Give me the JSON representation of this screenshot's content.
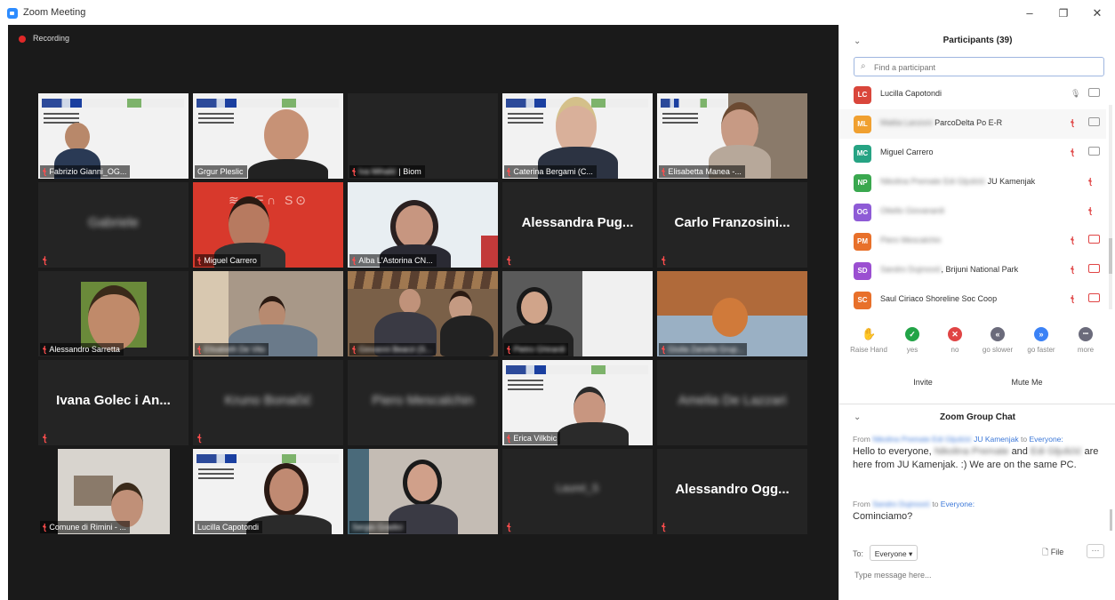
{
  "window": {
    "title": "Zoom Meeting",
    "controls": {
      "minimize": "–",
      "maximize": "❐",
      "close": "✕"
    }
  },
  "meeting": {
    "recording_label": "Recording",
    "tiles": [
      {
        "label": "Fabrizio Gianni_OG...",
        "blur": false,
        "mic_off": true
      },
      {
        "label": "Grgur Pleslic",
        "blur": false,
        "mic_off": false
      },
      {
        "label": "| Biom",
        "blur_prefix": "Iva Mihalić",
        "mic_off": true
      },
      {
        "label": "Caterina Bergami (C...",
        "blur": false,
        "mic_off": true
      },
      {
        "label": "Elisabetta Manea -...",
        "blur": false,
        "mic_off": true
      },
      {
        "big_name": "Gabriele",
        "blur": true
      },
      {
        "label": "Miguel Carrero",
        "blur": false,
        "mic_off": true
      },
      {
        "label": "Alba L'Astorina CN...",
        "blur": false,
        "mic_off": true
      },
      {
        "big_name": "Alessandra Pug...",
        "blur": false
      },
      {
        "big_name": "Carlo Franzosini...",
        "blur": false
      },
      {
        "label": "Alessandro Sarretta",
        "blur": false,
        "mic_off": true
      },
      {
        "label": "Elisabeth De Vito",
        "blur": true,
        "mic_off": true
      },
      {
        "label": "Giovanni Bearzi (S...",
        "blur": true,
        "mic_off": true
      },
      {
        "label": "Pietro Ghirardi",
        "blur": true,
        "mic_off": true
      },
      {
        "label": "Giulia Zanella Grup...",
        "blur": true,
        "mic_off": true
      },
      {
        "big_name": "Ivana Golec i An...",
        "blur": false
      },
      {
        "big_name": "Kruno Bonačić",
        "blur": true
      },
      {
        "big_name": "Piero Mescalchin",
        "blur": true
      },
      {
        "label": "Erica Vilkbic",
        "blur": false,
        "mic_off": true
      },
      {
        "big_name": "Amelia De Lazzari",
        "blur": true
      },
      {
        "label": "Comune di Rimini - ...",
        "blur": false,
        "mic_off": true
      },
      {
        "label": "Lucilla Capotondi",
        "blur": false,
        "mic_off": false
      },
      {
        "label": "Sergio Gradici",
        "blur": true,
        "mic_off": false
      },
      {
        "big_name": "Laurel_S",
        "blur": true
      },
      {
        "big_name": "Alessandro Ogg...",
        "blur": false
      }
    ],
    "slide_header": "www.menti.com 8633797"
  },
  "participants": {
    "title": "Participants (39)",
    "search_placeholder": "Find a participant",
    "list": [
      {
        "initials": "LC",
        "color": "#d9463b",
        "name": "Lucilla Capotondi",
        "name_blur": "",
        "mic": "on",
        "cam": "on"
      },
      {
        "initials": "ML",
        "color": "#f0a030",
        "name": "ParcoDelta Po E-R",
        "name_blur": "Mattia Lanzoni",
        "mic": "off",
        "cam": "on"
      },
      {
        "initials": "MC",
        "color": "#26a383",
        "name": "Miguel Carrero",
        "name_blur": "",
        "mic": "off",
        "cam": "on"
      },
      {
        "initials": "NP",
        "color": "#3aa84f",
        "name": "JU Kamenjak",
        "name_blur": "Nikolina Premate Edi Gljušćić",
        "mic": "off",
        "cam": "none"
      },
      {
        "initials": "OG",
        "color": "#8e5bd6",
        "name": "",
        "name_blur": "Ottello Giovanardi",
        "mic": "off",
        "cam": "none"
      },
      {
        "initials": "PM",
        "color": "#e8702a",
        "name": "",
        "name_blur": "Piero Mescalchin",
        "mic": "off",
        "cam": "off"
      },
      {
        "initials": "SD",
        "color": "#9b4fd1",
        "name": ", Brijuni National Park",
        "name_blur": "Sandro Dujmović",
        "mic": "off",
        "cam": "off"
      },
      {
        "initials": "SC",
        "color": "#e8702a",
        "name": "Saul Ciriaco Shoreline Soc Coop",
        "name_blur": "",
        "mic": "off",
        "cam": "off"
      }
    ],
    "reactions": [
      {
        "label": "Raise Hand",
        "glyph": "✋",
        "color": "#3b82f6"
      },
      {
        "label": "yes",
        "glyph": "✓",
        "color": "#22a447"
      },
      {
        "label": "no",
        "glyph": "✕",
        "color": "#e04545"
      },
      {
        "label": "go slower",
        "glyph": "«",
        "color": "#6b6b7b"
      },
      {
        "label": "go faster",
        "glyph": "»",
        "color": "#3b82f6"
      },
      {
        "label": "more",
        "glyph": "•••",
        "color": "#6b6b7b"
      }
    ],
    "invite_label": "Invite",
    "mute_me_label": "Mute Me"
  },
  "chat": {
    "title": "Zoom Group Chat",
    "messages": [
      {
        "from_prefix": "From",
        "from_blur": "Nikolina Premate Edi Gljušćić",
        "from_name": "JU Kamenjak",
        "to_word": "to",
        "to_name": "Everyone:",
        "text_1": "Hello to everyone,",
        "text_blur_1": "Nikolina Premate",
        "text_2": "and",
        "text_blur_2": "Edi Gljušćić",
        "text_3": "are here from JU Kamenjak. :) We are on the same PC."
      },
      {
        "from_prefix": "From",
        "from_blur": "Sandro Dujmović",
        "to_word": "to",
        "to_name": "Everyone:",
        "text": "Cominciamo?"
      }
    ],
    "to_label": "To:",
    "to_value": "Everyone ▾",
    "file_label": "File",
    "file_icon": "🗋",
    "more_label": "···",
    "input_placeholder": "Type message here..."
  }
}
